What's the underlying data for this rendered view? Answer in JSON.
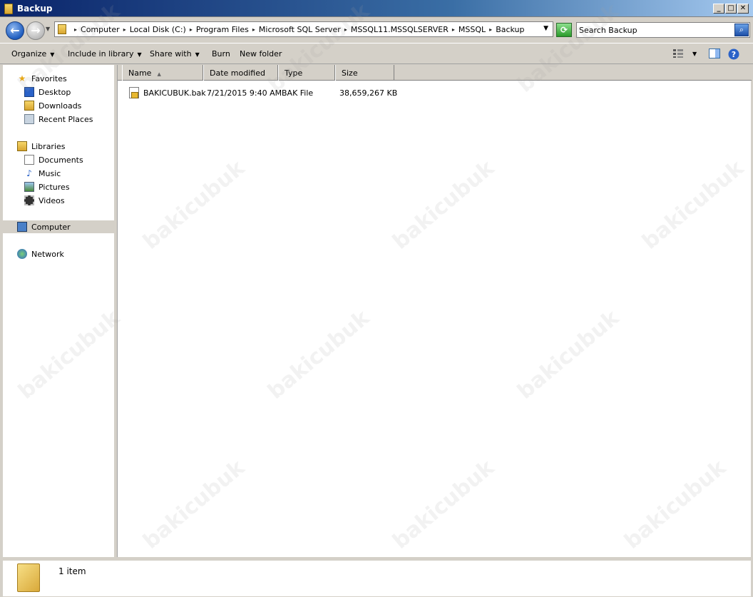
{
  "window": {
    "title": "Backup",
    "min_label": "_",
    "max_label": "□",
    "close_label": "✕"
  },
  "address": {
    "crumbs": [
      "Computer",
      "Local Disk (C:)",
      "Program Files",
      "Microsoft SQL Server",
      "MSSQL11.MSSQLSERVER",
      "MSSQL",
      "Backup"
    ]
  },
  "search": {
    "placeholder": "Search Backup"
  },
  "toolbar": {
    "organize": "Organize",
    "include": "Include in library",
    "share": "Share with",
    "burn": "Burn",
    "new_folder": "New folder"
  },
  "nav": {
    "favorites": "Favorites",
    "desktop": "Desktop",
    "downloads": "Downloads",
    "recent": "Recent Places",
    "libraries": "Libraries",
    "documents": "Documents",
    "music": "Music",
    "pictures": "Pictures",
    "videos": "Videos",
    "computer": "Computer",
    "network": "Network"
  },
  "columns": {
    "name": "Name",
    "date": "Date modified",
    "type": "Type",
    "size": "Size"
  },
  "files": [
    {
      "name": "BAKICUBUK.bak",
      "date": "7/21/2015 9:40 AM",
      "type": "BAK File",
      "size": "38,659,267 KB"
    }
  ],
  "status": {
    "count": "1 item"
  },
  "watermark": "bakicubuk"
}
